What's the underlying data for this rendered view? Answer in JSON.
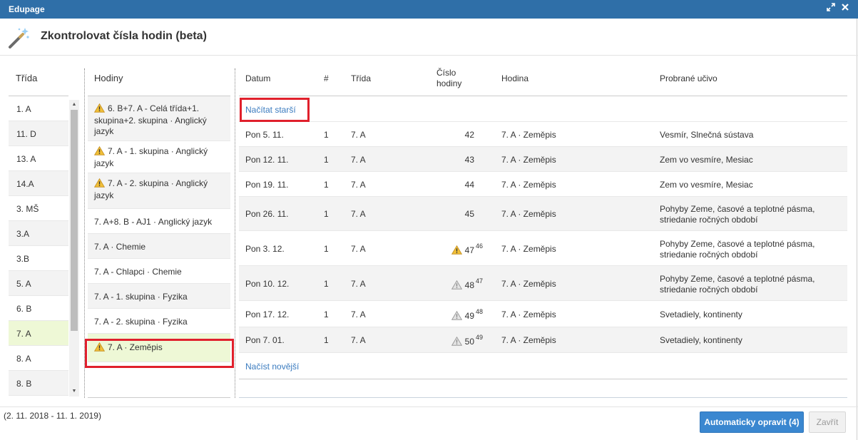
{
  "window": {
    "title": "Edupage",
    "expand_icon": "expand-icon",
    "close_icon": "close-icon"
  },
  "dialog": {
    "title": "Zkontrolovat čísla hodin (beta)",
    "icon": "magic-wand-icon"
  },
  "classes": {
    "header": "Třída",
    "items": [
      "1. A",
      "11. D",
      "13. A",
      "14.A",
      "3. MŠ",
      "3.A",
      "3.B",
      "5. A",
      "6. B",
      "7. A",
      "8. A",
      "8. B"
    ],
    "selected": "7. A"
  },
  "lessons": {
    "header": "Hodiny",
    "items": [
      {
        "label": "6. B+7. A - Celá třída+1. skupina+2. skupina · Anglický jazyk",
        "warning": true
      },
      {
        "label": "7. A - 1. skupina · Anglický jazyk",
        "warning": true
      },
      {
        "label": "7. A - 2. skupina · Anglický jazyk",
        "warning": true
      },
      {
        "label": "7. A+8. B - AJ1 · Anglický jazyk",
        "warning": false
      },
      {
        "label": "7. A · Chemie",
        "warning": false
      },
      {
        "label": "7. A - Chlapci · Chemie",
        "warning": false
      },
      {
        "label": "7. A - 1. skupina · Fyzika",
        "warning": false
      },
      {
        "label": "7. A - 2. skupina · Fyzika",
        "warning": false
      },
      {
        "label": "7. A · Zeměpis",
        "warning": true
      }
    ],
    "selected": "7. A · Zeměpis"
  },
  "grid": {
    "headers": {
      "date": "Datum",
      "num": "#",
      "class": "Třída",
      "lesson_number": "Číslo hodiny",
      "lesson": "Hodina",
      "topic": "Probrané učivo"
    },
    "load_older": "Načítat starší",
    "load_newer": "Načíst novější",
    "rows": [
      {
        "date": "Pon 5. 11.",
        "num": "1",
        "class": "7. A",
        "number": "42",
        "suggested": "",
        "warn": "",
        "lesson": "7. A · Zeměpis",
        "topic": "Vesmír, Slnečná sústava"
      },
      {
        "date": "Pon 12. 11.",
        "num": "1",
        "class": "7. A",
        "number": "43",
        "suggested": "",
        "warn": "",
        "lesson": "7. A · Zeměpis",
        "topic": "Zem vo vesmíre, Mesiac"
      },
      {
        "date": "Pon 19. 11.",
        "num": "1",
        "class": "7. A",
        "number": "44",
        "suggested": "",
        "warn": "",
        "lesson": "7. A · Zeměpis",
        "topic": "Zem vo vesmíre, Mesiac"
      },
      {
        "date": "Pon 26. 11.",
        "num": "1",
        "class": "7. A",
        "number": "45",
        "suggested": "",
        "warn": "",
        "lesson": "7. A · Zeměpis",
        "topic": "Pohyby Zeme, časové a teplotné pásma, striedanie ročných období"
      },
      {
        "date": "Pon 3. 12.",
        "num": "1",
        "class": "7. A",
        "number": "47",
        "suggested": "46",
        "warn": "yellow",
        "lesson": "7. A · Zeměpis",
        "topic": "Pohyby Zeme, časové a teplotné pásma, striedanie ročných období"
      },
      {
        "date": "Pon 10. 12.",
        "num": "1",
        "class": "7. A",
        "number": "48",
        "suggested": "47",
        "warn": "gray",
        "lesson": "7. A · Zeměpis",
        "topic": "Pohyby Zeme, časové a teplotné pásma, striedanie ročných období"
      },
      {
        "date": "Pon 17. 12.",
        "num": "1",
        "class": "7. A",
        "number": "49",
        "suggested": "48",
        "warn": "gray",
        "lesson": "7. A · Zeměpis",
        "topic": "Svetadiely, kontinenty"
      },
      {
        "date": "Pon 7. 01.",
        "num": "1",
        "class": "7. A",
        "number": "50",
        "suggested": "49",
        "warn": "gray",
        "lesson": "7. A · Zeměpis",
        "topic": "Svetadiely, kontinenty"
      }
    ]
  },
  "footer": {
    "date_range": "(2. 11. 2018 - 11. 1. 2019)",
    "auto_fix_label": "Automaticky opravit (4)",
    "close_label": "Zavřít"
  },
  "colors": {
    "titlebar": "#2f6fa8",
    "highlight": "#eef8d6",
    "red_box": "#e0202c",
    "link": "#3a7bbf",
    "primary_button": "#3a87d0"
  }
}
